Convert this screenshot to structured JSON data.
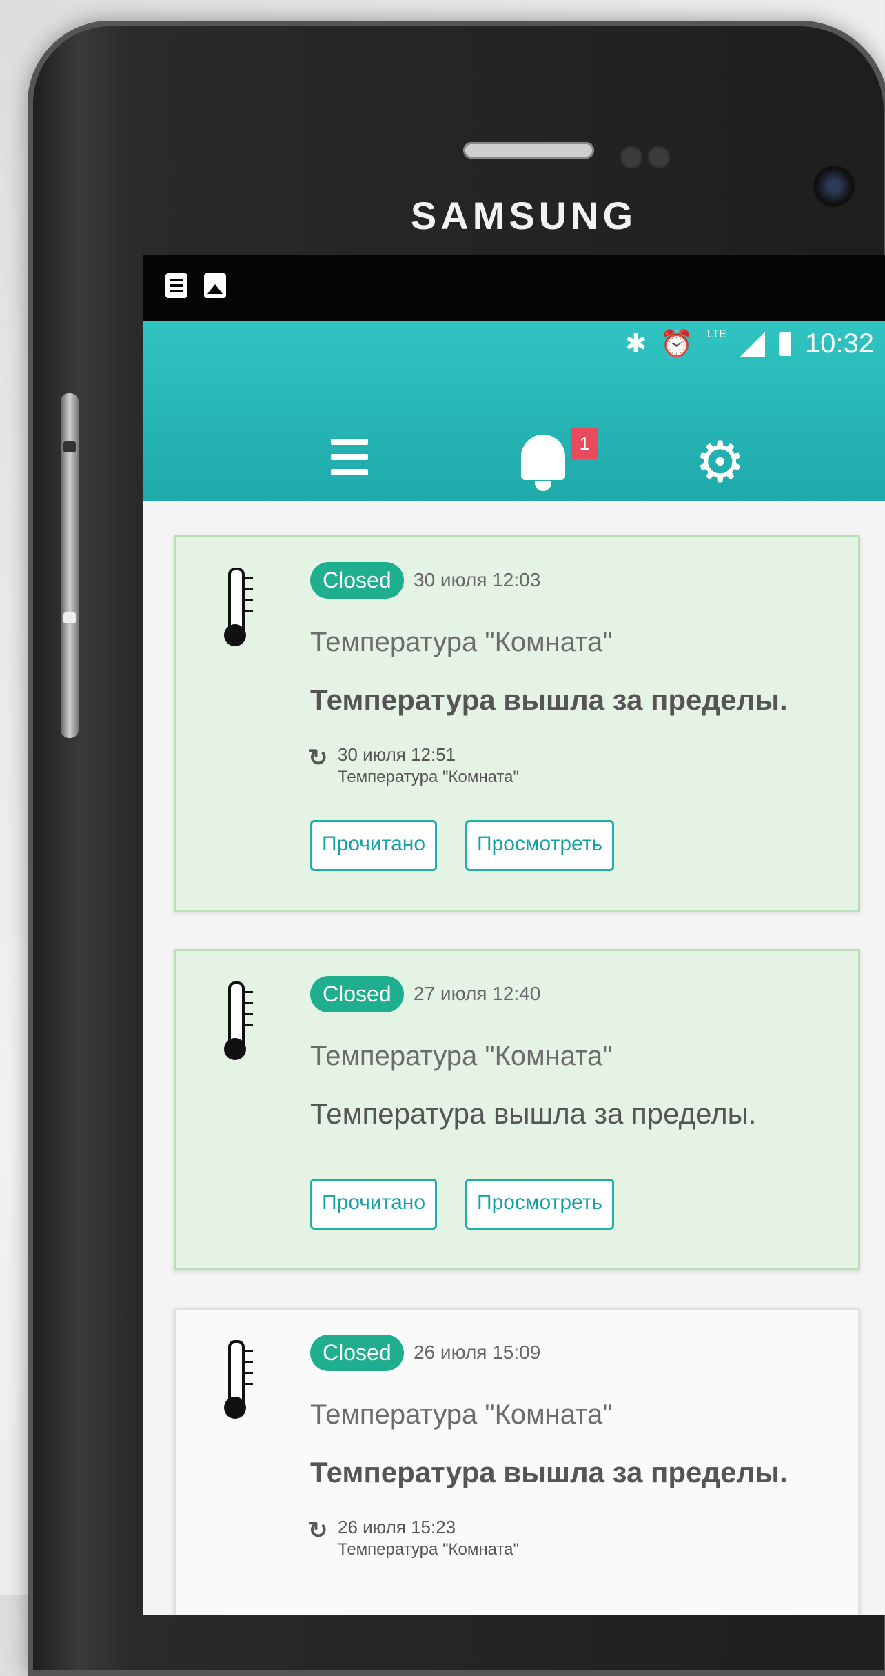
{
  "device": {
    "brand": "SAMSUNG"
  },
  "status_bar": {
    "time": "10:32",
    "network": "LTE"
  },
  "app_bar": {
    "notifications_count": "1"
  },
  "notifications": [
    {
      "status": "Closed",
      "datetime": "30 июля 12:03",
      "device": "Температура \"Комната\"",
      "message": "Температура вышла за пределы.",
      "history_date": "30 июля 12:51",
      "history_device": "Температура \"Комната\"",
      "read_label": "Прочитано",
      "view_label": "Просмотреть"
    },
    {
      "status": "Closed",
      "datetime": "27 июля 12:40",
      "device": "Температура \"Комната\"",
      "message": "Температура вышла за пределы.",
      "read_label": "Прочитано",
      "view_label": "Просмотреть"
    },
    {
      "status": "Closed",
      "datetime": "26 июля 15:09",
      "device": "Температура \"Комната\"",
      "message": "Температура вышла за пределы.",
      "history_date": "26 июля 15:23",
      "history_device": "Температура \"Комната\""
    }
  ],
  "icons": {
    "menu": "menu-icon",
    "bell": "bell-icon",
    "settings": "gear-icon",
    "thermometer": "thermometer-icon",
    "history": "history-icon"
  },
  "colors": {
    "accent": "#1fb0a6",
    "app_bar": "#22b4b3",
    "badge": "#e94a5e",
    "status_closed": "#1fae8e",
    "card_unread": "#e4f3e3"
  }
}
